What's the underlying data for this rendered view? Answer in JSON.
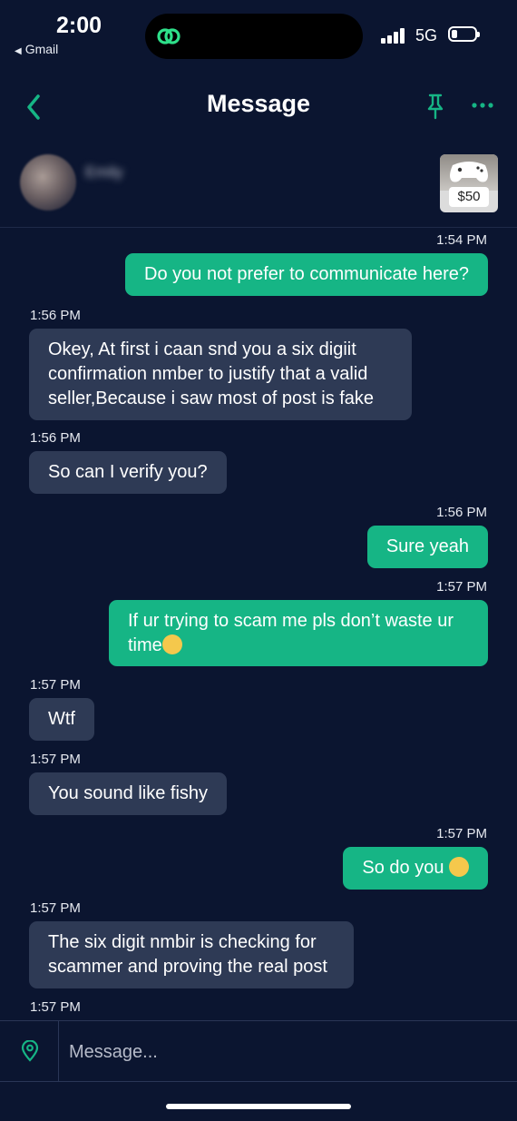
{
  "status_bar": {
    "time": "2:00",
    "back_app": "Gmail",
    "network": "5G"
  },
  "header": {
    "title": "Message"
  },
  "contact": {
    "name": "Emily",
    "listing_price": "$50"
  },
  "messages": [
    {
      "direction": "out",
      "time": "1:54 PM",
      "text": "Do you not prefer to communicate here?"
    },
    {
      "direction": "in",
      "time": "1:56 PM",
      "text": "Okey, At first i caan snd you a six digiit confirmation nmber  to justify that a valid seller,Because i saw most of post is fake"
    },
    {
      "direction": "in",
      "time": "1:56 PM",
      "text": "So can I verify you?"
    },
    {
      "direction": "out",
      "time": "1:56 PM",
      "text": "Sure yeah"
    },
    {
      "direction": "out",
      "time": "1:57 PM",
      "text": "If ur trying to scam me pls don’t waste ur time",
      "emoji": "face-holding-back-tears"
    },
    {
      "direction": "in",
      "time": "1:57 PM",
      "text": "Wtf"
    },
    {
      "direction": "in",
      "time": "1:57 PM",
      "text": "You sound like fishy"
    },
    {
      "direction": "out",
      "time": "1:57 PM",
      "text": "So do you ",
      "emoji": "face-with-tears-of-joy"
    },
    {
      "direction": "in",
      "time": "1:57 PM",
      "text": "The six digit nmbir is checking for scammer and proving the real post"
    },
    {
      "direction": "in",
      "time": "1:57 PM",
      "text": ""
    }
  ],
  "composer": {
    "placeholder": "Message..."
  },
  "colors": {
    "background": "#0b1530",
    "accent": "#16b585",
    "incoming_bubble": "#2e3a55"
  }
}
